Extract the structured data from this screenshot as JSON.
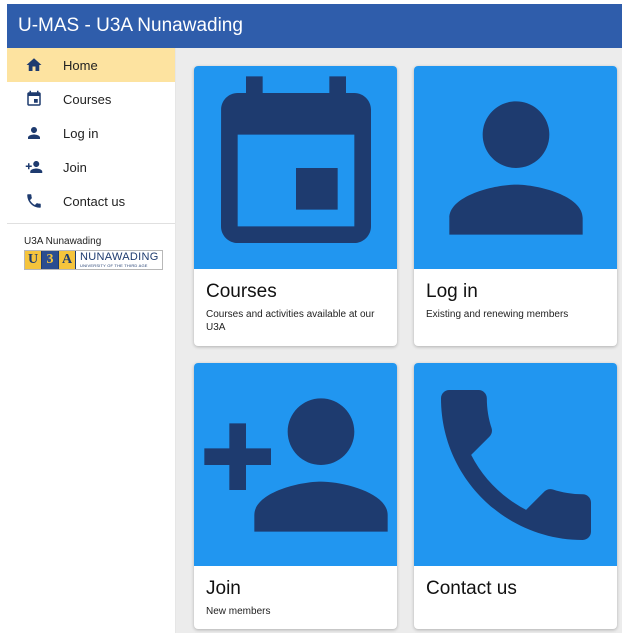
{
  "app": {
    "title": "U-MAS - U3A Nunawading"
  },
  "sidebar": {
    "items": [
      {
        "label": "Home",
        "icon": "home-icon",
        "active": true
      },
      {
        "label": "Courses",
        "icon": "calendar-icon",
        "active": false
      },
      {
        "label": "Log in",
        "icon": "person-icon",
        "active": false
      },
      {
        "label": "Join",
        "icon": "person-add-icon",
        "active": false
      },
      {
        "label": "Contact us",
        "icon": "phone-icon",
        "active": false
      }
    ],
    "org_name": "U3A Nunawading",
    "logo": {
      "letters": [
        "U",
        "3",
        "A"
      ],
      "main": "NUNAWADING",
      "sub": "UNIVERSITY OF THE THIRD AGE"
    }
  },
  "cards": [
    {
      "title": "Courses",
      "description": "Courses and activities available at our U3A",
      "icon": "calendar-icon"
    },
    {
      "title": "Log in",
      "description": "Existing and renewing members",
      "icon": "person-icon"
    },
    {
      "title": "Join",
      "description": "New members",
      "icon": "person-add-icon"
    },
    {
      "title": "Contact us",
      "description": "",
      "icon": "phone-icon"
    }
  ],
  "colors": {
    "appbar": "#2f5dab",
    "active_nav": "#fde3a0",
    "card_image_bg": "#2196f0",
    "icon_fill": "#1e3b6f",
    "main_bg": "#ececec"
  }
}
